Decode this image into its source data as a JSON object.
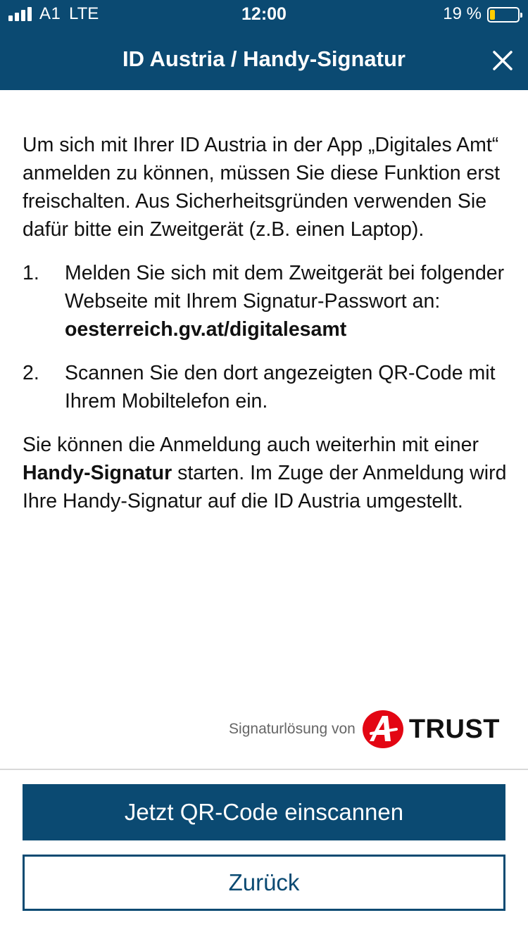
{
  "status_bar": {
    "carrier": "A1",
    "network": "LTE",
    "time": "12:00",
    "battery_percent": "19 %",
    "battery_level": 0.19
  },
  "header": {
    "title": "ID Austria / Handy-Signatur",
    "close_icon": "close-icon"
  },
  "content": {
    "intro": "Um sich mit Ihrer ID Austria in der App „Digitales Amt“ anmelden zu können, müssen Sie diese Funktion erst freischalten. Aus Sicherheitsgründen verwenden Sie dafür bitte ein Zweitgerät (z.B. einen Laptop).",
    "steps": [
      {
        "number": "1.",
        "text": "Melden Sie sich mit dem Zweitgerät bei folgender Webseite mit Ihrem Signatur-Passwort an:",
        "link": "oesterreich.gv.at/digitalesamt"
      },
      {
        "number": "2.",
        "text": "Scannen Sie den dort angezeigten QR-Code mit Ihrem Mobiltelefon ein."
      }
    ],
    "outro_before": "Sie können die Anmeldung auch weiterhin mit einer",
    "outro_bold": "Handy-Signatur",
    "outro_after": "starten. Im Zuge der Anmeldung wird Ihre Handy-Signatur auf die ID Austria umgestellt."
  },
  "provider": {
    "label": "Signaturlösung von",
    "logo_text": "TRUST",
    "logo_icon": "a-trust-logo-icon"
  },
  "buttons": {
    "scan": "Jetzt QR-Code einscannen",
    "back": "Zurück"
  },
  "colors": {
    "primary": "#0b4a72",
    "logo_red": "#e30613",
    "battery": "#ffcc00"
  }
}
